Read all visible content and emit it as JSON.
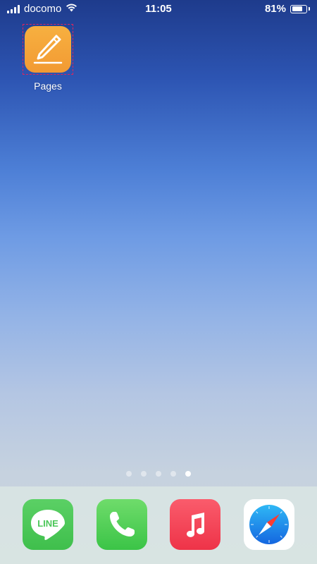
{
  "status_bar": {
    "carrier": "docomo",
    "time": "11:05",
    "battery_percent": "81%",
    "battery_level": 0.81,
    "signal_bars": 4,
    "icons": [
      "signal-bars-icon",
      "wifi-icon",
      "battery-icon"
    ]
  },
  "home": {
    "apps": [
      {
        "label": "Pages",
        "icon": "pages-pen-icon",
        "color": "#f5a33a"
      }
    ]
  },
  "page_dots": {
    "count": 5,
    "active_index": 4
  },
  "dock": {
    "apps": [
      {
        "name": "LINE",
        "icon": "line-icon",
        "icon_text": "LINE",
        "color": "#4cc759"
      },
      {
        "name": "Phone",
        "icon": "phone-icon",
        "color": "#4cd062"
      },
      {
        "name": "Music",
        "icon": "music-icon",
        "color": "#f43a51"
      },
      {
        "name": "Safari",
        "icon": "safari-compass-icon",
        "color": "#1a7fe8"
      }
    ]
  }
}
